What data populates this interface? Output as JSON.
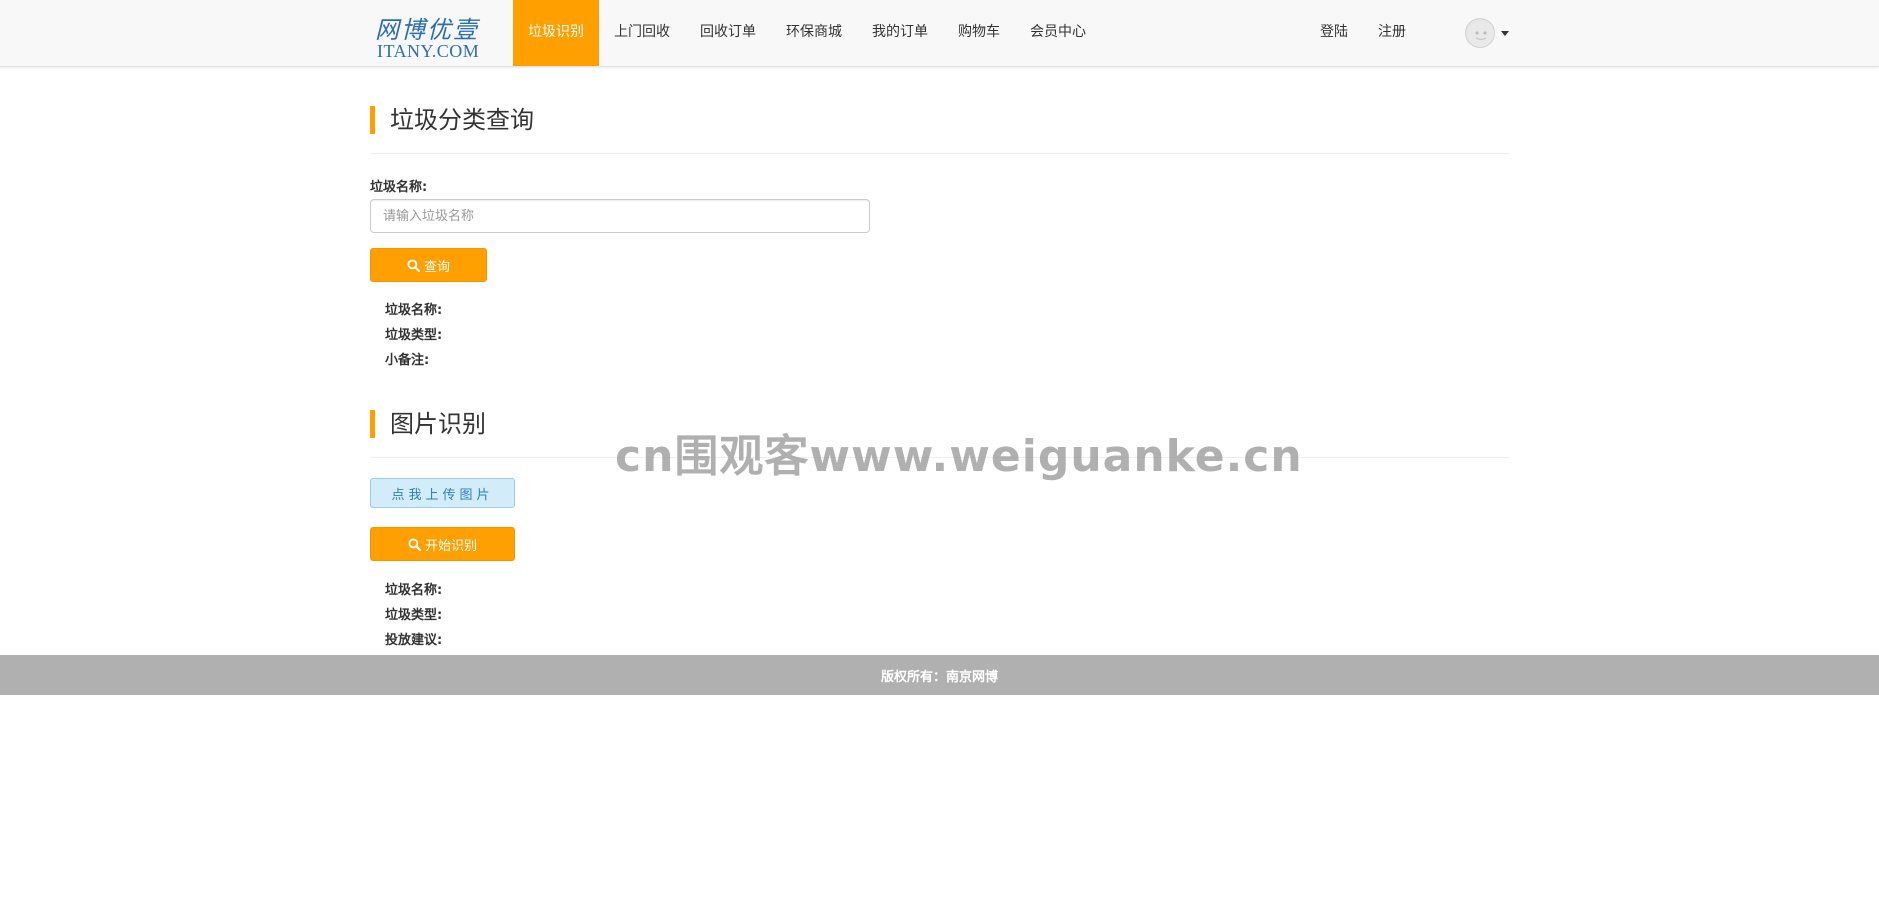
{
  "header": {
    "logo": {
      "cn": "网博优壹",
      "en": "ITANY.COM"
    },
    "nav": [
      {
        "label": "垃圾识别",
        "active": true
      },
      {
        "label": "上门回收"
      },
      {
        "label": "回收订单"
      },
      {
        "label": "环保商城"
      },
      {
        "label": "我的订单"
      },
      {
        "label": "购物车"
      },
      {
        "label": "会员中心"
      }
    ],
    "login": "登陆",
    "register": "注册",
    "avatar_icon": "user-avatar-icon",
    "dropdown_icon": "caret-down-icon"
  },
  "query_section": {
    "title": "垃圾分类查询",
    "field_label": "垃圾名称:",
    "input_placeholder": "请输入垃圾名称",
    "input_value": "",
    "button_label": "查询",
    "button_icon": "search-icon",
    "results": [
      {
        "label": "垃圾名称:"
      },
      {
        "label": "垃圾类型:"
      },
      {
        "label": "小备注:"
      }
    ]
  },
  "image_section": {
    "title": "图片识别",
    "upload_label": "点我上传图片",
    "button_label": "开始识别",
    "button_icon": "search-icon",
    "results": [
      {
        "label": "垃圾名称:"
      },
      {
        "label": "垃圾类型:"
      },
      {
        "label": "投放建议:"
      }
    ]
  },
  "watermark": "cn围观客www.weiguanke.cn",
  "footer": {
    "text": "版权所有：南京网博"
  },
  "colors": {
    "accent": "#ff9f00",
    "upload_bg": "#d2ecfa",
    "footer_bg": "#b0b0b0"
  }
}
